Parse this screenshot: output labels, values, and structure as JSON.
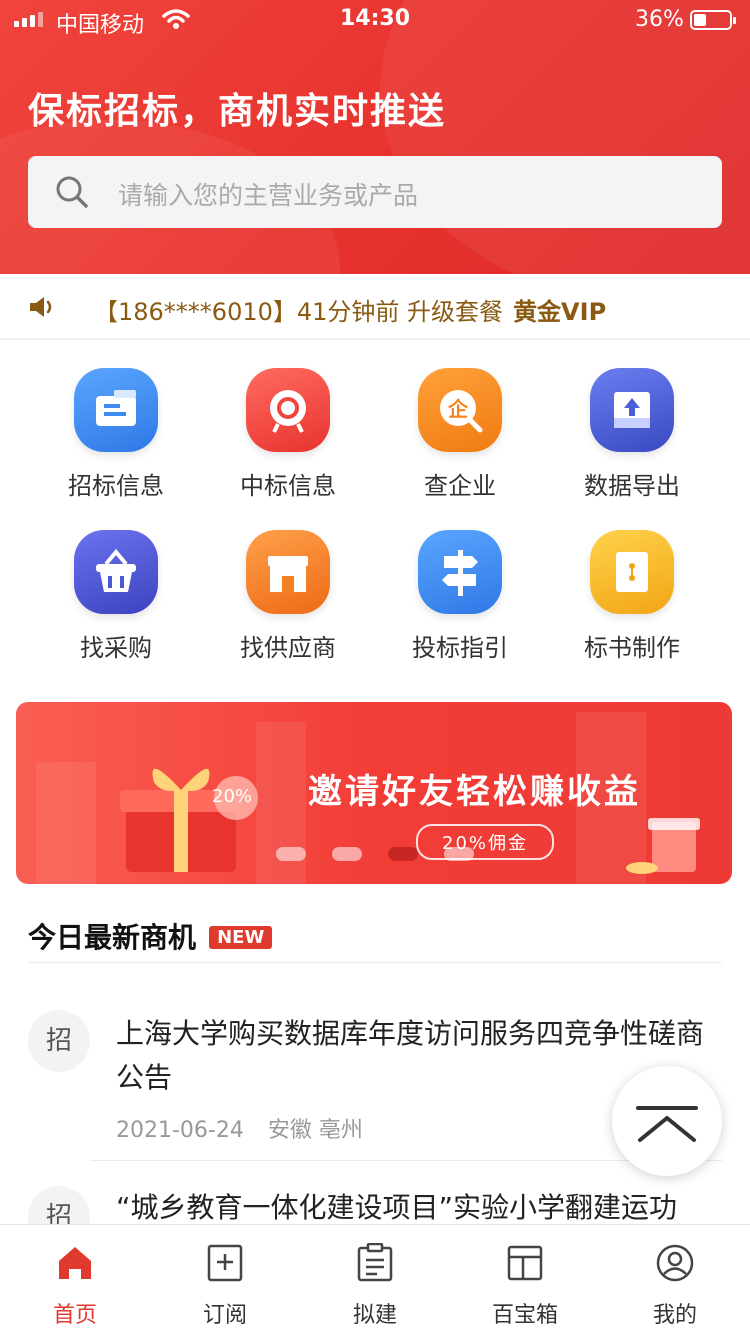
{
  "status_bar": {
    "carrier": "中国移动",
    "time": "14:30",
    "battery": "36%"
  },
  "header": {
    "slogan": "保标招标，商机实时推送",
    "search_placeholder": "请输入您的主营业务或产品"
  },
  "notice": {
    "text": "【186****6010】41分钟前 升级套餐",
    "highlight": "黄金VIP"
  },
  "grid": [
    {
      "label": "招标信息",
      "icon": "bidding-info-icon",
      "color": "#3d8df0"
    },
    {
      "label": "中标信息",
      "icon": "winning-bid-icon",
      "color": "#f0453c"
    },
    {
      "label": "查企业",
      "icon": "enterprise-search-icon",
      "color": "#f5841f"
    },
    {
      "label": "数据导出",
      "icon": "data-export-icon",
      "color": "#4a5fd6"
    },
    {
      "label": "找采购",
      "icon": "purchase-basket-icon",
      "color": "#4f58d4"
    },
    {
      "label": "找供应商",
      "icon": "supplier-store-icon",
      "color": "#f5801f"
    },
    {
      "label": "投标指引",
      "icon": "signpost-icon",
      "color": "#3d8df0"
    },
    {
      "label": "标书制作",
      "icon": "document-making-icon",
      "color": "#f6b71c"
    }
  ],
  "banner": {
    "title": "邀请好友轻松赚收益",
    "subtitle": "20%佣金",
    "badge": "20%"
  },
  "section": {
    "title": "今日最新商机",
    "badge": "NEW"
  },
  "opportunities": [
    {
      "tag": "招",
      "title": "上海大学购买数据库年度访问服务四竞争性磋商公告",
      "date": "2021-06-24",
      "location": "安徽 亳州"
    },
    {
      "tag": "招",
      "title": "“城乡教育一体化建设项目”实验小学翻建运功"
    }
  ],
  "tabbar": [
    {
      "label": "首页",
      "icon": "home-icon",
      "active": true
    },
    {
      "label": "订阅",
      "icon": "subscribe-icon",
      "active": false
    },
    {
      "label": "拟建",
      "icon": "proposed-project-icon",
      "active": false
    },
    {
      "label": "百宝箱",
      "icon": "toolbox-icon",
      "active": false
    },
    {
      "label": "我的",
      "icon": "profile-icon",
      "active": false
    }
  ],
  "colors": {
    "brand_red": "#e8332f",
    "vip_gold": "#8a5a12",
    "text_dark": "#222222",
    "text_muted": "#999999"
  }
}
